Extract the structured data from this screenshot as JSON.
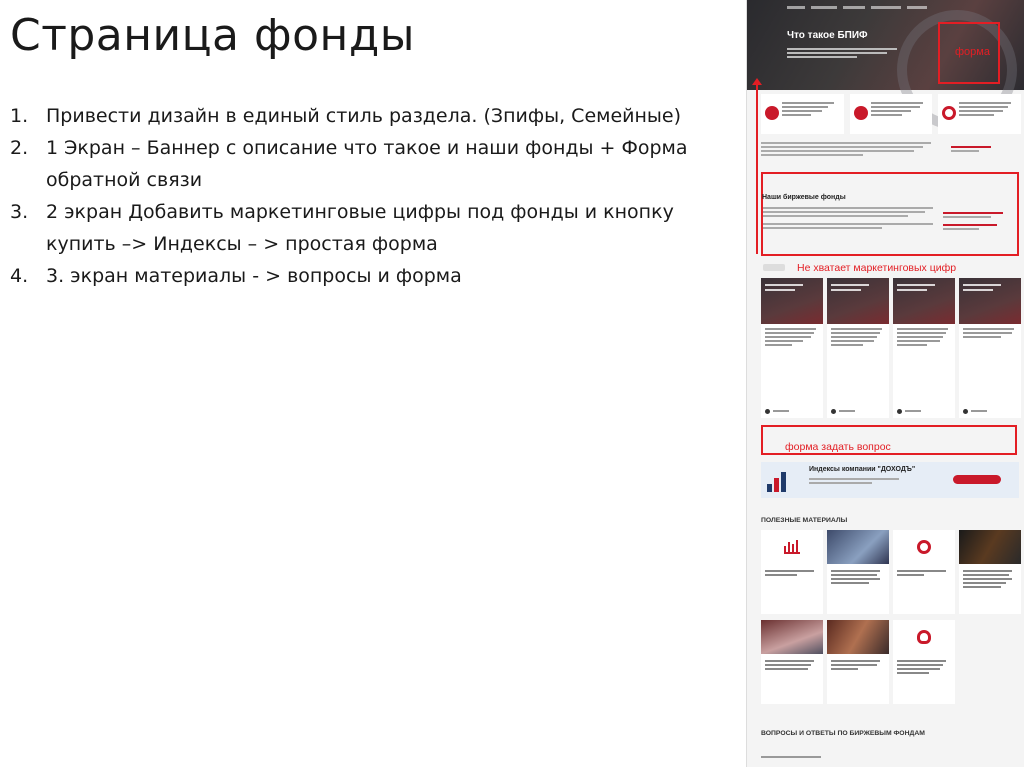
{
  "slide": {
    "title": "Страница фонды",
    "tasks": [
      {
        "num": "1.",
        "text": "Привести дизайн в единый стиль раздела. (Зпифы, Семейные)"
      },
      {
        "num": "2.",
        "text": "1 Экран – Баннер с описание что такое и наши фонды + Форма обратной связи"
      },
      {
        "num": "3.",
        "text": "2 экран Добавить маркетинговые цифры под фонды и кнопку купить –> Индексы – > простая форма"
      },
      {
        "num": "4.",
        "text": "3. экран материалы - >  вопросы и форма"
      }
    ]
  },
  "screenshot": {
    "hero_title": "Что такое БПИФ",
    "annotation_form": "форма",
    "etf_title": "Наши биржевые фонды",
    "annotation_missing": "Не хватает маркетинговых цифр",
    "annotation_ask": "форма задать вопрос",
    "index_title": "Индексы компании \"ДОХОДЪ\"",
    "materials_title": "ПОЛЕЗНЫЕ МАТЕРИАЛЫ",
    "qa_title": "ВОПРОСЫ И ОТВЕТЫ ПО БИРЖЕВЫМ ФОНДАМ"
  },
  "colors": {
    "annotation": "#e31e24",
    "brand": "#c9192a"
  }
}
